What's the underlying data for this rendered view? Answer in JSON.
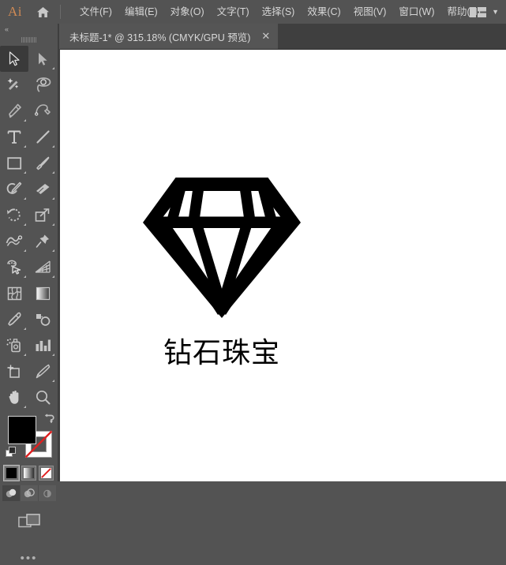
{
  "app": {
    "name": "Ai",
    "logo_color": "#d08a54",
    "chrome_color": "#535353",
    "panel_color": "#3f3f3f"
  },
  "menubar": {
    "home_icon": "home-icon",
    "items": [
      {
        "label": "文件(F)"
      },
      {
        "label": "编辑(E)"
      },
      {
        "label": "对象(O)"
      },
      {
        "label": "文字(T)"
      },
      {
        "label": "选择(S)"
      },
      {
        "label": "效果(C)"
      },
      {
        "label": "视图(V)"
      },
      {
        "label": "窗口(W)"
      },
      {
        "label": "帮助(H)"
      }
    ],
    "workspace_switcher_icon": "workspace-layout-icon",
    "workspace_chevron": "▼"
  },
  "tabbar": {
    "tab_title": "未标题-1* @ 315.18% (CMYK/GPU 预览)",
    "close_label": "✕"
  },
  "toolbar": {
    "collapse_label": "«",
    "more_label": "•••",
    "tools": [
      {
        "name": "selection-tool",
        "icon": "arrow-solid-icon",
        "active": true,
        "corner": false
      },
      {
        "name": "direct-selection-tool",
        "icon": "arrow-hollow-icon",
        "active": false,
        "corner": true
      },
      {
        "name": "magic-wand-tool",
        "icon": "magic-wand-icon",
        "active": false,
        "corner": false
      },
      {
        "name": "lasso-tool",
        "icon": "lasso-icon",
        "active": false,
        "corner": false
      },
      {
        "name": "pen-tool",
        "icon": "pen-icon",
        "active": false,
        "corner": true
      },
      {
        "name": "curvature-tool",
        "icon": "curvature-icon",
        "active": false,
        "corner": false
      },
      {
        "name": "type-tool",
        "icon": "type-t-icon",
        "active": false,
        "corner": true
      },
      {
        "name": "line-segment-tool",
        "icon": "line-icon",
        "active": false,
        "corner": true
      },
      {
        "name": "rectangle-tool",
        "icon": "rectangle-icon",
        "active": false,
        "corner": true
      },
      {
        "name": "paintbrush-tool",
        "icon": "paintbrush-icon",
        "active": false,
        "corner": true
      },
      {
        "name": "shaper-tool",
        "icon": "shaper-pencil-icon",
        "active": false,
        "corner": true
      },
      {
        "name": "eraser-tool",
        "icon": "eraser-icon",
        "active": false,
        "corner": true
      },
      {
        "name": "rotate-tool",
        "icon": "rotate-icon",
        "active": false,
        "corner": true
      },
      {
        "name": "scale-tool",
        "icon": "scale-icon",
        "active": false,
        "corner": true
      },
      {
        "name": "width-tool",
        "icon": "width-warp-icon",
        "active": false,
        "corner": true
      },
      {
        "name": "free-transform-tool",
        "icon": "pushpin-icon",
        "active": false,
        "corner": true
      },
      {
        "name": "shape-builder-tool",
        "icon": "shape-builder-icon",
        "active": false,
        "corner": true
      },
      {
        "name": "perspective-grid-tool",
        "icon": "perspective-grid-icon",
        "active": false,
        "corner": true
      },
      {
        "name": "mesh-tool",
        "icon": "mesh-icon",
        "active": false,
        "corner": false
      },
      {
        "name": "gradient-tool",
        "icon": "gradient-icon",
        "active": false,
        "corner": false
      },
      {
        "name": "eyedropper-tool",
        "icon": "eyedropper-icon",
        "active": false,
        "corner": true
      },
      {
        "name": "blend-tool",
        "icon": "blend-icon",
        "active": false,
        "corner": false
      },
      {
        "name": "symbol-sprayer-tool",
        "icon": "symbol-sprayer-icon",
        "active": false,
        "corner": true
      },
      {
        "name": "column-graph-tool",
        "icon": "bar-chart-icon",
        "active": false,
        "corner": true
      },
      {
        "name": "artboard-tool",
        "icon": "artboard-icon",
        "active": false,
        "corner": false
      },
      {
        "name": "slice-tool",
        "icon": "slice-knife-icon",
        "active": false,
        "corner": true
      },
      {
        "name": "hand-tool",
        "icon": "hand-icon",
        "active": false,
        "corner": true
      },
      {
        "name": "zoom-tool",
        "icon": "magnifier-icon",
        "active": false,
        "corner": false
      }
    ],
    "fill_color": "#000000",
    "stroke_color": "#ffffff",
    "stroke_is_none": true,
    "swap_icon": "swap-arrow-icon",
    "default_colors_icon": "default-fill-stroke-icon",
    "color_modes": [
      {
        "name": "color-mode-color",
        "icon": "solid-color-icon",
        "selected": true
      },
      {
        "name": "color-mode-gradient",
        "icon": "gradient-swatch-icon",
        "selected": false
      },
      {
        "name": "color-mode-none",
        "icon": "none-swatch-icon",
        "selected": false
      }
    ],
    "draw_modes": [
      {
        "name": "draw-normal",
        "icon": "draw-normal-icon",
        "selected": true
      },
      {
        "name": "draw-behind",
        "icon": "draw-behind-icon",
        "selected": false
      },
      {
        "name": "draw-inside",
        "icon": "draw-inside-icon",
        "selected": false
      }
    ],
    "screen_mode": {
      "name": "change-screen-mode",
      "icon": "screen-mode-icon"
    }
  },
  "artwork": {
    "logo_shape": "diamond-outline-icon",
    "logo_label": "钻石珠宝",
    "logo_color": "#000000"
  }
}
